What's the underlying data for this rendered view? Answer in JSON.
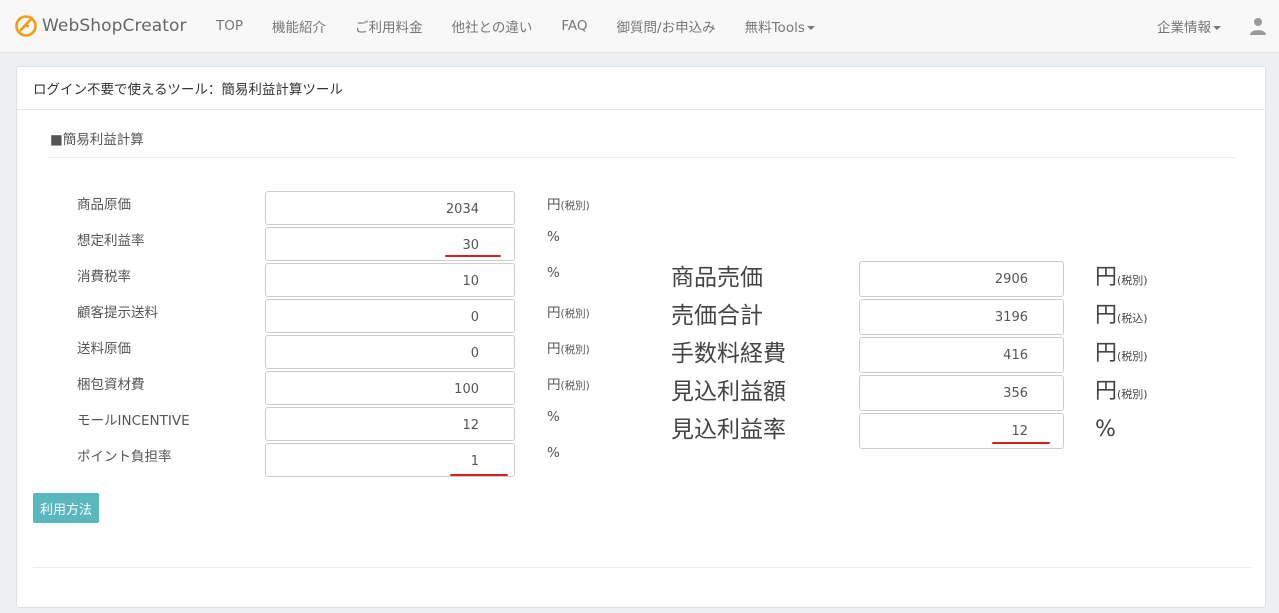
{
  "brand": {
    "name": "WebShopCreator",
    "icon": "bitcoin-like-logo-icon"
  },
  "nav": {
    "links": [
      "TOP",
      "機能紹介",
      "ご利用料金",
      "他社との違い",
      "FAQ",
      "御質問/お申込み",
      "無料Tools"
    ],
    "company": "企業情報",
    "user_icon": "user-icon"
  },
  "panel": {
    "heading": "ログイン不要で使えるツール：簡易利益計算ツール",
    "section_title": "■簡易利益計算"
  },
  "form": {
    "rows": [
      {
        "label": "商品原価",
        "value": "2034",
        "unit": "円",
        "unit_note": "(税別)"
      },
      {
        "label": "想定利益率",
        "value": "30",
        "unit": "%",
        "unit_note": ""
      },
      {
        "label": "消費税率",
        "value": "10",
        "unit": "%",
        "unit_note": ""
      },
      {
        "label": "顧客提示送料",
        "value": "0",
        "unit": "円",
        "unit_note": "(税別)"
      },
      {
        "label": "送料原価",
        "value": "0",
        "unit": "円",
        "unit_note": "(税別)"
      },
      {
        "label": "梱包資材費",
        "value": "100",
        "unit": "円",
        "unit_note": "(税別)"
      },
      {
        "label": "モールINCENTIVE",
        "value": "12",
        "unit": "%",
        "unit_note": ""
      },
      {
        "label": "ポイント負担率",
        "value": "1",
        "unit": "%",
        "unit_note": ""
      }
    ]
  },
  "results": {
    "rows": [
      {
        "label": "商品売価",
        "value": "2906",
        "unit": "円",
        "unit_note": "(税別)"
      },
      {
        "label": "売価合計",
        "value": "3196",
        "unit": "円",
        "unit_note": "(税込)"
      },
      {
        "label": "手数料経費",
        "value": "416",
        "unit": "円",
        "unit_note": "(税別)"
      },
      {
        "label": "見込利益額",
        "value": "356",
        "unit": "円",
        "unit_note": "(税別)"
      },
      {
        "label": "見込利益率",
        "value": "12",
        "unit": "%",
        "unit_note": ""
      }
    ]
  },
  "usage_button": "利用方法",
  "colors": {
    "accent_red": "#d62020",
    "button_teal": "#5ab7bd",
    "logo_orange": "#f39c12"
  }
}
